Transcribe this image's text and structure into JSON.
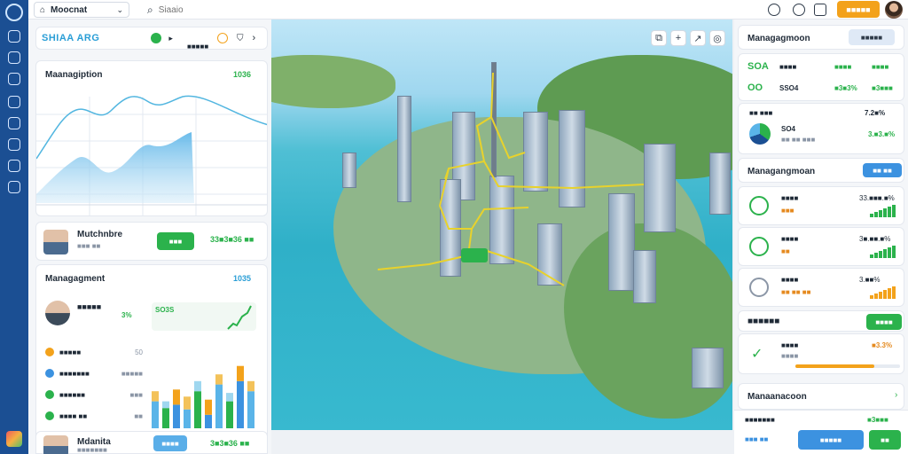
{
  "app": {
    "workspace": "Moocnat",
    "search_placeholder": "Siaaio",
    "cta_label": "■■■■■"
  },
  "left": {
    "brand": "SHIAA ARG",
    "toolbar_label": "■■■■■",
    "chart_card": {
      "title": "Maanagiption",
      "value": "1036"
    },
    "profile": {
      "name": "Mutchnbre",
      "sub": "■■■ ■■",
      "button": "■■■",
      "value": "33■3■36 ■■"
    },
    "mgmt": {
      "title": "Managagment",
      "value": "1035",
      "person": {
        "name": "■■■■■",
        "pct": "3%",
        "mini": "SO3S"
      },
      "items": [
        {
          "label": "■■■■■",
          "value": "50"
        },
        {
          "label": "■■■■■■■",
          "value": "■■■■■"
        },
        {
          "label": "■■■■■■",
          "value": "■■■"
        },
        {
          "label": "■■■■ ■■",
          "value": "■■"
        }
      ],
      "bars": [
        {
          "a": 40,
          "b": 30
        },
        {
          "a": 30,
          "b": 20
        },
        {
          "a": 35,
          "b": 45
        },
        {
          "a": 28,
          "b": 38
        },
        {
          "a": 55,
          "b": 30
        },
        {
          "a": 20,
          "b": 45
        },
        {
          "a": 65,
          "b": 30
        },
        {
          "a": 40,
          "b": 25
        },
        {
          "a": 70,
          "b": 45
        },
        {
          "a": 55,
          "b": 30
        }
      ]
    },
    "footer": {
      "name": "Mdanita",
      "sub": "■■■■■■■",
      "button": "■■■■",
      "value": "3■3■36 ■■"
    }
  },
  "right": {
    "head": {
      "title": "Managagmoon",
      "button": "■■■■■"
    },
    "stats": [
      {
        "label": "SOA",
        "name": "■■■■",
        "v1": "■■■■",
        "v2": "■■■■"
      },
      {
        "label": "OO",
        "name": "SSO4",
        "v1": "■3■3%",
        "v2": "■3■■■"
      }
    ],
    "pie": {
      "label": "■■ ■■■",
      "pct": "7.2■%",
      "name": "SO4",
      "sub": "■■ ■■ ■■■",
      "value": "3.■3.■%"
    },
    "head2": {
      "title": "Managangmoan",
      "button": "■■ ■■"
    },
    "list": [
      {
        "name": "■■■■",
        "sub": "■■■",
        "value": "33.■■■.■%"
      },
      {
        "name": "■■■■",
        "sub": "■■",
        "value": "3■.■■.■%"
      },
      {
        "name": "■■■■",
        "sub": "■■ ■■ ■■",
        "value": "3.■■%"
      }
    ],
    "section": {
      "title": "■■■■■■",
      "button": "■■■■"
    },
    "progress": {
      "name": "■■■■",
      "value": "■3.3%",
      "sub": "■■■■",
      "pct": 0.75
    },
    "footer": {
      "title": "Manaanacoon",
      "list_label": "■■■■■■■",
      "sub": "■■■ ■■",
      "value": "■3■■■",
      "btn1": "■■■■■",
      "btn2": "■■"
    }
  }
}
